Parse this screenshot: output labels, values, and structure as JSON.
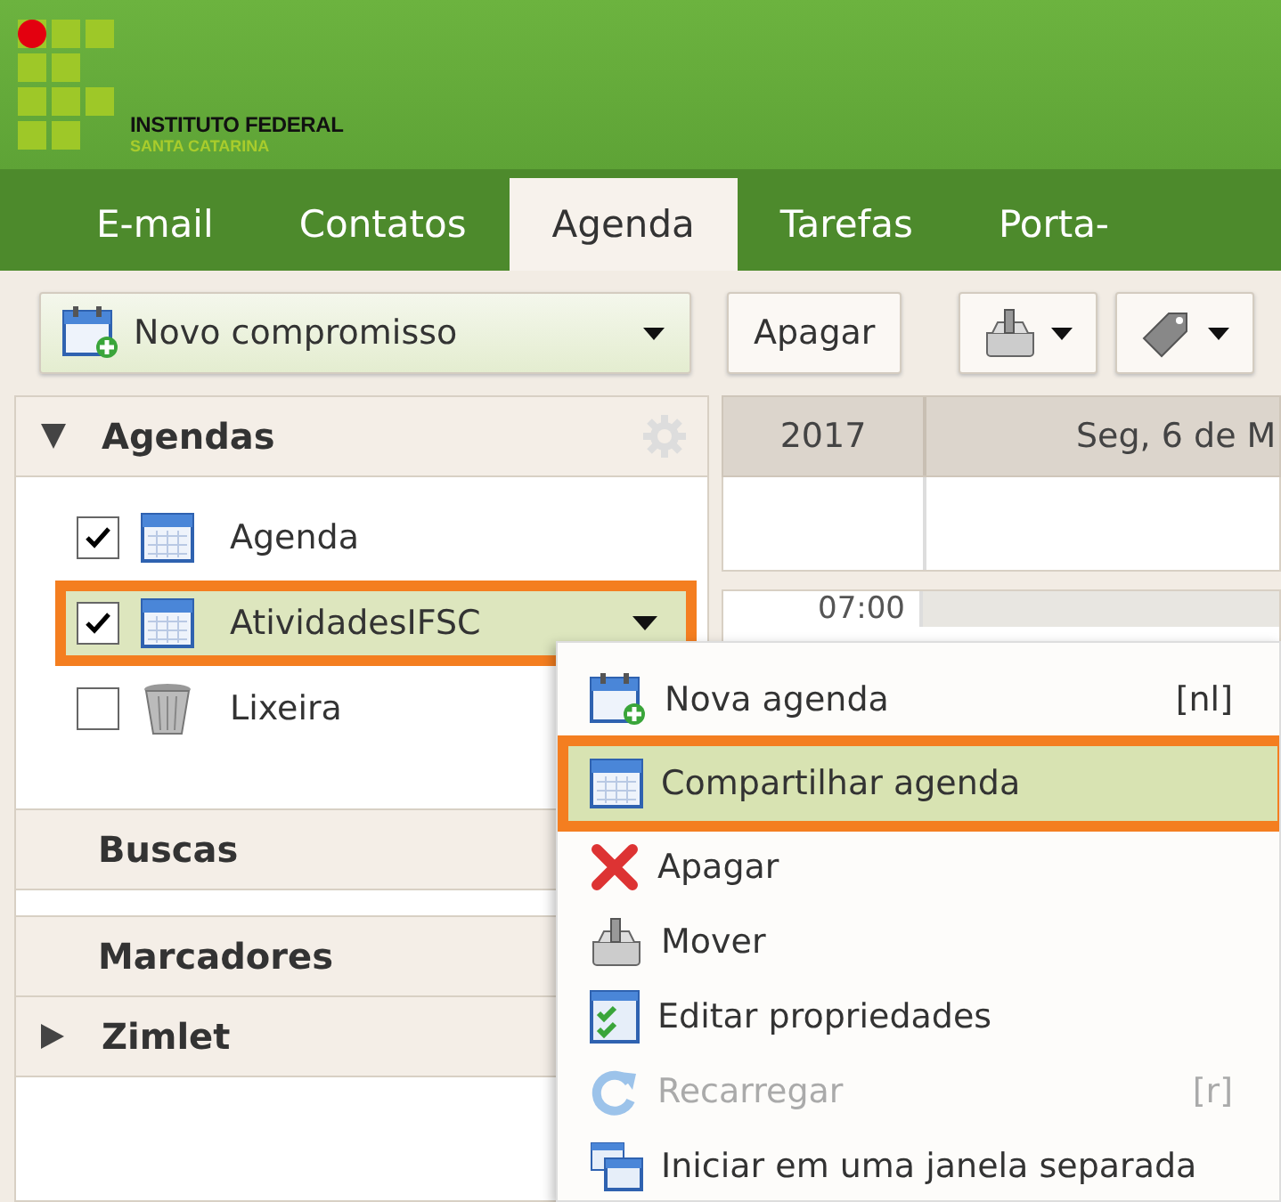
{
  "logo": {
    "title": "INSTITUTO FEDERAL",
    "subtitle": "SANTA CATARINA"
  },
  "tabs": [
    {
      "label": "E-mail",
      "selected": false
    },
    {
      "label": "Contatos",
      "selected": false
    },
    {
      "label": "Agenda",
      "selected": true
    },
    {
      "label": "Tarefas",
      "selected": false
    },
    {
      "label": "Porta-",
      "selected": false
    }
  ],
  "toolbar": {
    "new_button": "Novo compromisso",
    "delete_button": "Apagar"
  },
  "sidebar": {
    "sections": [
      {
        "title": "Agendas",
        "expanded": true,
        "items": [
          {
            "label": "Agenda",
            "kind": "calendar",
            "checked": true,
            "selected": false,
            "annotated": false
          },
          {
            "label": "AtividadesIFSC",
            "kind": "calendar",
            "checked": true,
            "selected": true,
            "annotated": true
          },
          {
            "label": "Lixeira",
            "kind": "trash",
            "checked": false,
            "selected": false,
            "annotated": false
          }
        ]
      },
      {
        "title": "Buscas"
      },
      {
        "title": "Marcadores"
      },
      {
        "title": "Zimlet",
        "expanded": false
      }
    ]
  },
  "calendar": {
    "year": "2017",
    "day_header": "Seg, 6 de M",
    "times": [
      "07:00"
    ]
  },
  "context_menu": {
    "items": [
      {
        "label": "Nova agenda",
        "shortcut": "[nl]",
        "kind": "new-calendar",
        "disabled": false,
        "selected": false,
        "annotated": false
      },
      {
        "label": "Compartilhar agenda",
        "kind": "calendar",
        "disabled": false,
        "selected": true,
        "annotated": true
      },
      {
        "label": "Apagar",
        "kind": "delete",
        "disabled": false,
        "selected": false,
        "annotated": false
      },
      {
        "label": "Mover",
        "kind": "move",
        "disabled": false,
        "selected": false,
        "annotated": false
      },
      {
        "label": "Editar propriedades",
        "kind": "edit",
        "disabled": false,
        "selected": false,
        "annotated": false
      },
      {
        "label": "Recarregar",
        "shortcut": "[r]",
        "kind": "reload",
        "disabled": true,
        "selected": false,
        "annotated": false
      },
      {
        "label": "Iniciar em uma janela separada",
        "kind": "window",
        "disabled": false,
        "selected": false,
        "annotated": false
      }
    ]
  }
}
